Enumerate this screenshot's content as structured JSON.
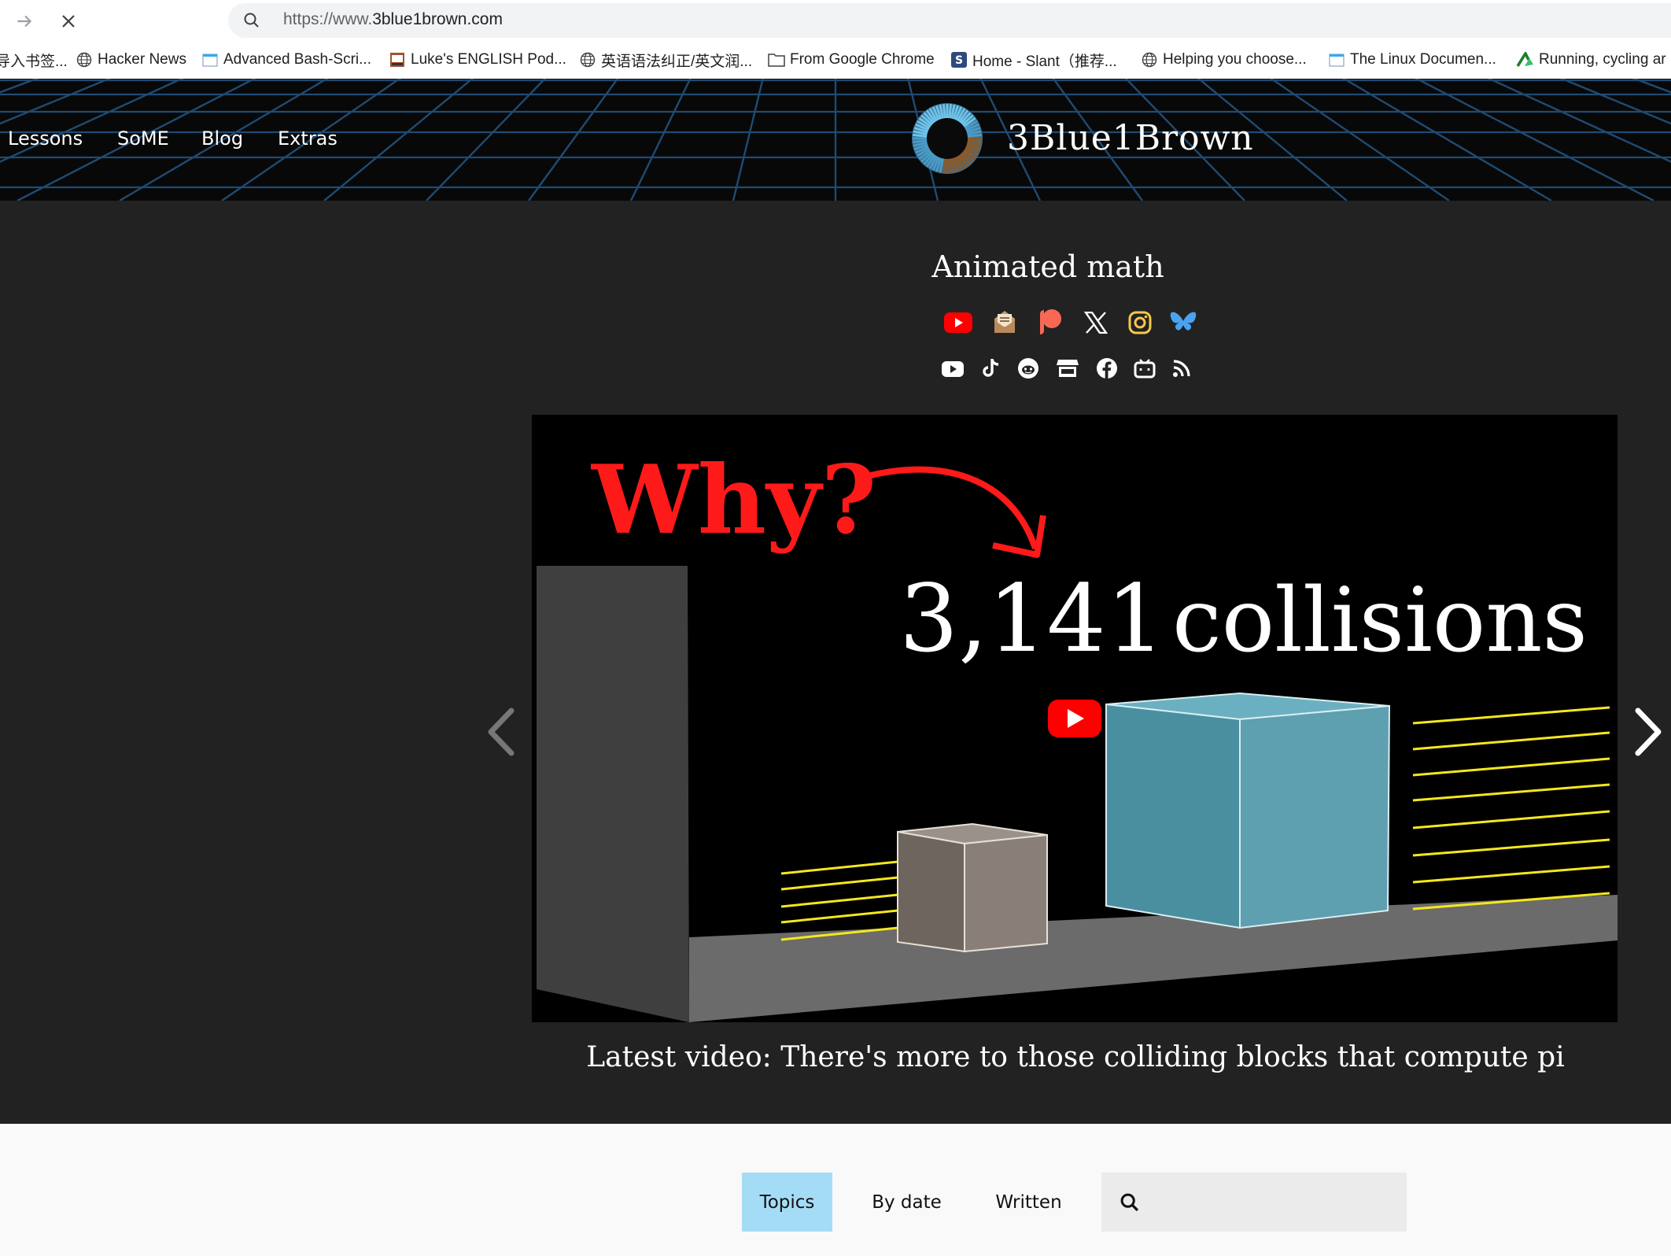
{
  "browser": {
    "url_prefix": "https://www.",
    "url_domain": "3blue1brown.com",
    "bookmarks": [
      {
        "label": "导入书签...",
        "icon": "folder-icon"
      },
      {
        "label": "Hacker News",
        "icon": "globe-icon"
      },
      {
        "label": "Advanced Bash-Scri...",
        "icon": "page-icon"
      },
      {
        "label": "Luke's ENGLISH Pod...",
        "icon": "podcast-icon"
      },
      {
        "label": "英语语法纠正/英文润...",
        "icon": "globe-icon"
      },
      {
        "label": "From Google Chrome",
        "icon": "folder-icon"
      },
      {
        "label": "Home - Slant（推荐...",
        "icon": "slant-icon"
      },
      {
        "label": "Helping you choose...",
        "icon": "globe-icon"
      },
      {
        "label": "The Linux Documen...",
        "icon": "page-icon"
      },
      {
        "label": "Running, cycling ar",
        "icon": "strava-icon"
      }
    ]
  },
  "site": {
    "nav": [
      "Lessons",
      "SoME",
      "Blog",
      "Extras"
    ],
    "logo_text": "3Blue1Brown",
    "tagline": "Animated math",
    "social_row1": [
      "youtube-icon",
      "mail-icon",
      "patreon-icon",
      "x-icon",
      "instagram-icon",
      "bluesky-icon"
    ],
    "social_row2": [
      "youtube-alt-icon",
      "tiktok-icon",
      "reddit-icon",
      "store-icon",
      "facebook-icon",
      "bilibili-icon",
      "rss-icon"
    ]
  },
  "video": {
    "thumb_why": "Why?",
    "thumb_count": "3,141",
    "thumb_word": "collisions",
    "caption": "Latest video: There's more to those colliding blocks that compute pi"
  },
  "tabs": {
    "topics": "Topics",
    "by_date": "By date",
    "written": "Written"
  },
  "colors": {
    "hero_bg": "#222222",
    "active_tab": "#a5dcf5",
    "thumb_red": "#ff1a1a",
    "big_block": "#4a8fa0",
    "small_block": "#8a7e78"
  }
}
